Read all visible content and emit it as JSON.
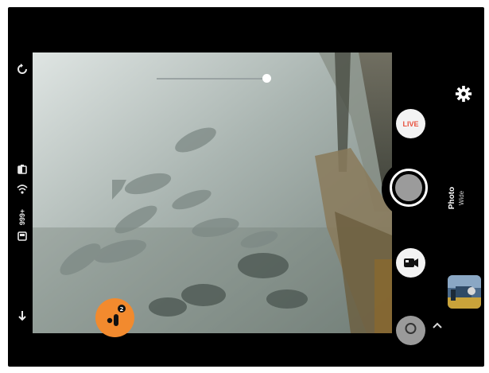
{
  "status": {
    "storage": "999+",
    "wifi_icon": "wifi-icon",
    "signal_icon": "signal-icon",
    "battery_icon": "battery-icon"
  },
  "left_rail": {
    "rotate_icon": "rotate-icon",
    "back_icon": "back-arrow-icon"
  },
  "zoom": {
    "level": 1.0
  },
  "controls": {
    "live_label": "LIVE",
    "video_icon": "video-camera-icon",
    "settings_icon": "gear-icon",
    "expand_icon": "chevron-up-icon"
  },
  "mode": {
    "name": "Photo",
    "sub": "Wide"
  },
  "lens_button": {
    "icon": "lens-switch-icon",
    "color": "#f28a2e"
  },
  "colors": {
    "frame": "#000000",
    "live": "#e8513d",
    "shutter_inner": "#9b9b9b"
  }
}
